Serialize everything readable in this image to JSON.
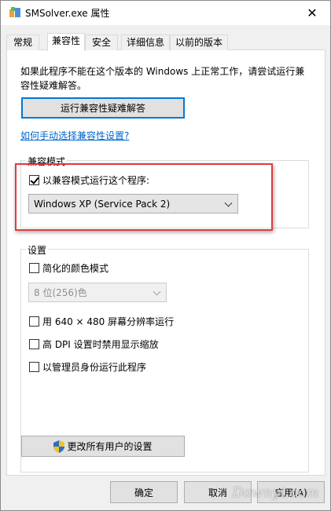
{
  "window": {
    "title": "SMSolver.exe 属性",
    "close_glyph": "✕"
  },
  "tabs": [
    {
      "label": "常规"
    },
    {
      "label": "兼容性"
    },
    {
      "label": "安全"
    },
    {
      "label": "详细信息"
    },
    {
      "label": "以前的版本"
    }
  ],
  "active_tab": "兼容性",
  "compat": {
    "intro": "如果此程序不能在这个版本的 Windows 上正常工作，请尝试运行兼容性疑难解答。",
    "troubleshoot_button": "运行兼容性疑难解答",
    "manual_link": "如何手动选择兼容性设置?"
  },
  "compat_mode": {
    "group_title": "兼容模式",
    "checkbox_label": "以兼容模式运行这个程序:",
    "checked": true,
    "selected_os": "Windows XP (Service Pack 2)"
  },
  "settings": {
    "group_title": "设置",
    "reduced_color_label": "简化的颜色模式",
    "color_select": "8 位(256)色",
    "run_640_label": "用 640 × 480 屏幕分辨率运行",
    "dpi_label": "高 DPI 设置时禁用显示缩放",
    "admin_label": "以管理员身份运行此程序"
  },
  "all_users_button": "更改所有用户的设置",
  "footer": {
    "ok": "确定",
    "cancel": "取消",
    "apply": "应用(A)"
  },
  "watermark": "Downyi.com",
  "colors": {
    "highlight_border": "#e23b3b",
    "link": "#0066cc",
    "focus": "#0078d7"
  }
}
